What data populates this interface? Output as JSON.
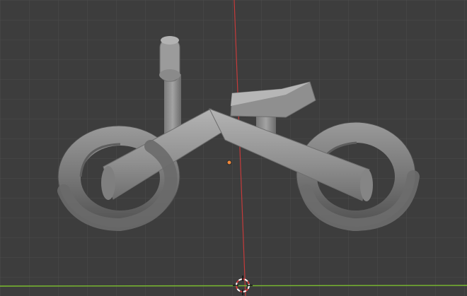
{
  "viewport": {
    "background": "#3d3d3d",
    "grid_color": "#4a4a4a",
    "x_axis_color": "#7bbd2f",
    "y_axis_color": "#c73a3a",
    "origin_color": "#f0883a"
  },
  "scene": {
    "object": "balance-bike-model",
    "material_color": "#8e8e8e"
  },
  "icons": {
    "cursor": "3d-cursor-icon",
    "origin": "object-origin-icon"
  }
}
